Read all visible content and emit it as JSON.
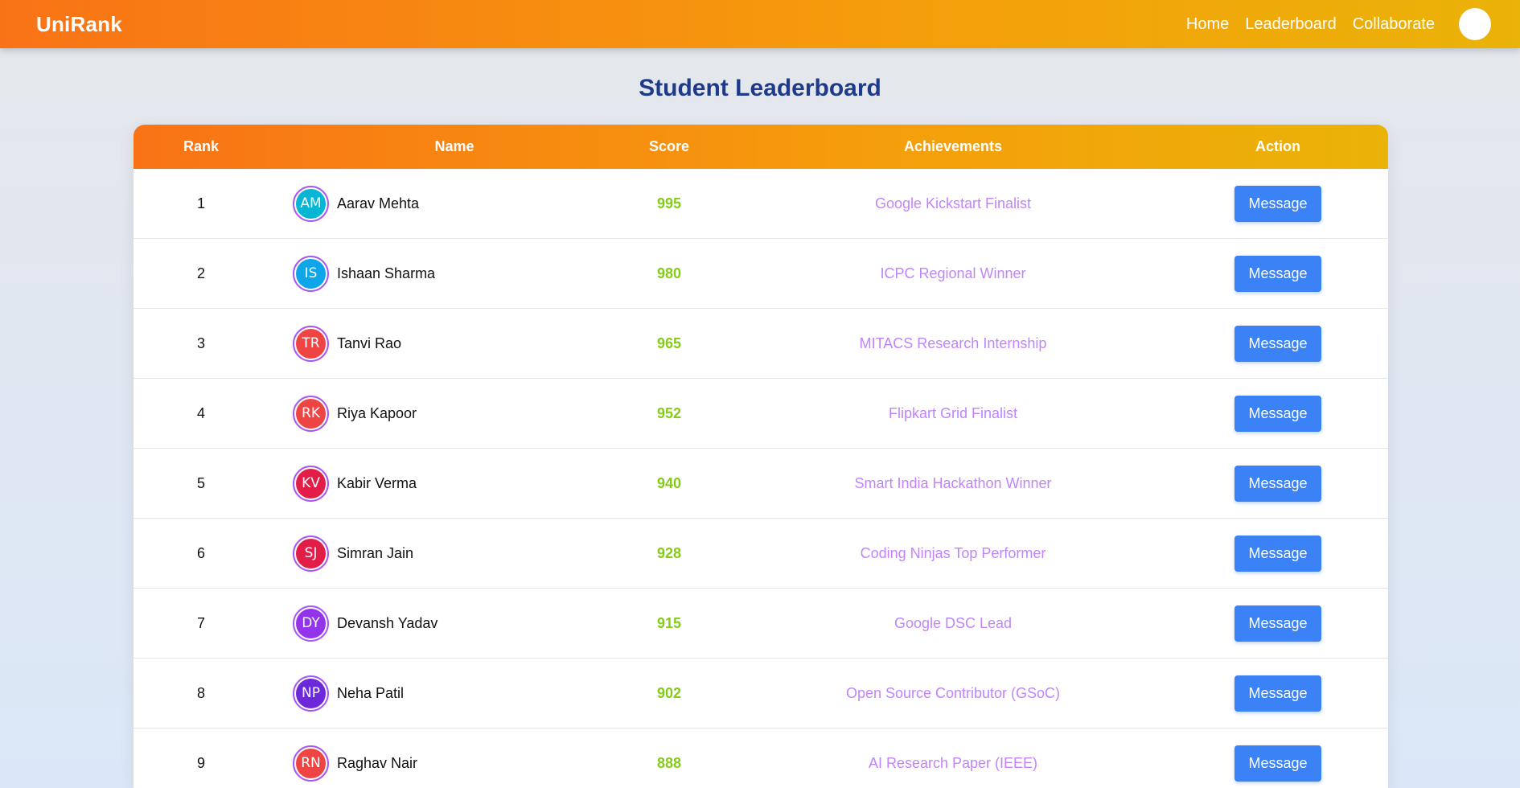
{
  "nav": {
    "brand": "UniRank",
    "links": [
      "Home",
      "Leaderboard",
      "Collaborate"
    ]
  },
  "page": {
    "title": "Student Leaderboard"
  },
  "table": {
    "headers": [
      "Rank",
      "Name",
      "Score",
      "Achievements",
      "Action"
    ],
    "rows": [
      {
        "rank": "1",
        "initials": "AM",
        "avatar_color": "#06b6d4",
        "name": "Aarav Mehta",
        "score": "995",
        "achievement": "Google Kickstart Finalist",
        "action": "Message"
      },
      {
        "rank": "2",
        "initials": "IS",
        "avatar_color": "#0ea5e9",
        "name": "Ishaan Sharma",
        "score": "980",
        "achievement": "ICPC Regional Winner",
        "action": "Message"
      },
      {
        "rank": "3",
        "initials": "TR",
        "avatar_color": "#ef4444",
        "name": "Tanvi Rao",
        "score": "965",
        "achievement": "MITACS Research Internship",
        "action": "Message"
      },
      {
        "rank": "4",
        "initials": "RK",
        "avatar_color": "#ef4444",
        "name": "Riya Kapoor",
        "score": "952",
        "achievement": "Flipkart Grid Finalist",
        "action": "Message"
      },
      {
        "rank": "5",
        "initials": "KV",
        "avatar_color": "#e11d48",
        "name": "Kabir Verma",
        "score": "940",
        "achievement": "Smart India Hackathon Winner",
        "action": "Message"
      },
      {
        "rank": "6",
        "initials": "SJ",
        "avatar_color": "#e11d48",
        "name": "Simran Jain",
        "score": "928",
        "achievement": "Coding Ninjas Top Performer",
        "action": "Message"
      },
      {
        "rank": "7",
        "initials": "DY",
        "avatar_color": "#9333ea",
        "name": "Devansh Yadav",
        "score": "915",
        "achievement": "Google DSC Lead",
        "action": "Message"
      },
      {
        "rank": "8",
        "initials": "NP",
        "avatar_color": "#6d28d9",
        "name": "Neha Patil",
        "score": "902",
        "achievement": "Open Source Contributor (GSoC)",
        "action": "Message"
      },
      {
        "rank": "9",
        "initials": "RN",
        "avatar_color": "#ef4444",
        "name": "Raghav Nair",
        "score": "888",
        "achievement": "AI Research Paper (IEEE)",
        "action": "Message"
      }
    ]
  }
}
